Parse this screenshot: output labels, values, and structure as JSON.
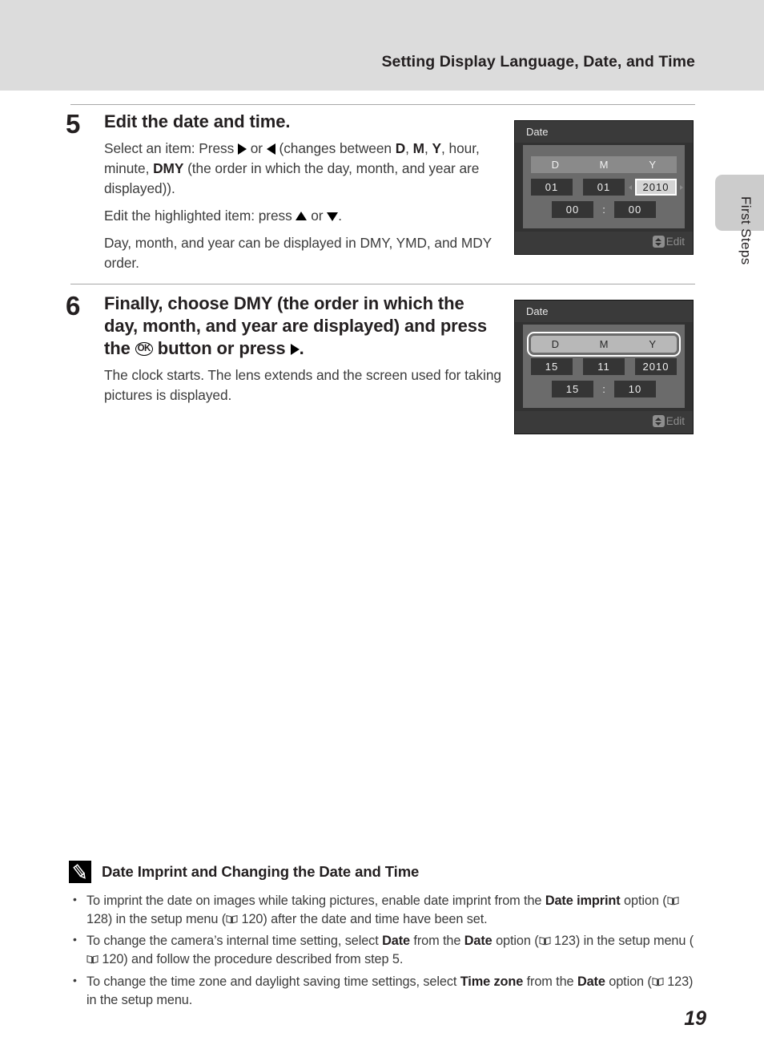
{
  "header": {
    "title": "Setting Display Language, Date, and Time"
  },
  "side_tab": {
    "label": "First Steps"
  },
  "steps": [
    {
      "number": "5",
      "heading": "Edit the date and time.",
      "paragraphs": [
        {
          "segments": [
            {
              "t": "Select an item: Press "
            },
            {
              "icon": "triangle-right-icon"
            },
            {
              "t": " or "
            },
            {
              "icon": "triangle-left-icon"
            },
            {
              "t": " (changes between "
            },
            {
              "t": "D",
              "b": true
            },
            {
              "t": ", "
            },
            {
              "t": "M",
              "b": true
            },
            {
              "t": ", "
            },
            {
              "t": "Y",
              "b": true
            },
            {
              "t": ", hour, minute, "
            },
            {
              "t": "DMY",
              "b": true
            },
            {
              "t": " (the order in which the day, month, and year are displayed))."
            }
          ]
        },
        {
          "segments": [
            {
              "t": "Edit the highlighted item: press "
            },
            {
              "icon": "triangle-up-icon"
            },
            {
              "t": " or "
            },
            {
              "icon": "triangle-down-icon"
            },
            {
              "t": "."
            }
          ]
        },
        {
          "segments": [
            {
              "t": "Day, month, and year can be displayed in DMY, YMD, and MDY order."
            }
          ]
        }
      ]
    },
    {
      "number": "6",
      "heading_segments": [
        {
          "t": "Finally, choose "
        },
        {
          "t": "DMY",
          "b": true
        },
        {
          "t": " (the order in which the day, month, and year are displayed) and press the "
        },
        {
          "icon": "ok-button-icon",
          "label": "OK"
        },
        {
          "t": " button or press "
        },
        {
          "icon": "triangle-right-icon"
        },
        {
          "t": "."
        }
      ],
      "paragraphs": [
        {
          "segments": [
            {
              "t": "The clock starts. The lens extends and the screen used for taking pictures is displayed."
            }
          ]
        }
      ]
    }
  ],
  "camera_screens": [
    {
      "title": "Date",
      "columns": [
        "D",
        "M",
        "Y"
      ],
      "values": [
        "01",
        "01",
        "2010"
      ],
      "selected_field": "year",
      "header_selected": false,
      "hour": "00",
      "minute": "00",
      "separator": ":",
      "footer_label": "Edit",
      "footer_icon": "up-down-arrow-icon"
    },
    {
      "title": "Date",
      "columns": [
        "D",
        "M",
        "Y"
      ],
      "values": [
        "15",
        "11",
        "2010"
      ],
      "selected_field": "order",
      "header_selected": true,
      "hour": "15",
      "minute": "10",
      "separator": ":",
      "footer_label": "Edit",
      "footer_icon": "up-down-arrow-icon"
    }
  ],
  "note": {
    "icon": "pencil-icon",
    "title": "Date Imprint and Changing the Date and Time",
    "bullets": [
      {
        "segments": [
          {
            "t": "To imprint the date on images while taking pictures, enable date imprint from the "
          },
          {
            "t": "Date imprint",
            "b": true
          },
          {
            "t": " option ("
          },
          {
            "icon": "book-icon"
          },
          {
            "t": " 128) in the setup menu ("
          },
          {
            "icon": "book-icon"
          },
          {
            "t": " 120) after the date and time have been set."
          }
        ]
      },
      {
        "segments": [
          {
            "t": "To change the camera’s internal time setting, select "
          },
          {
            "t": "Date",
            "b": true
          },
          {
            "t": " from the "
          },
          {
            "t": "Date",
            "b": true
          },
          {
            "t": " option ("
          },
          {
            "icon": "book-icon"
          },
          {
            "t": " 123) in the setup menu ("
          },
          {
            "icon": "book-icon"
          },
          {
            "t": " 120) and follow the procedure described from step 5."
          }
        ]
      },
      {
        "segments": [
          {
            "t": "To change the time zone and daylight saving time settings, select "
          },
          {
            "t": "Time zone",
            "b": true
          },
          {
            "t": " from the "
          },
          {
            "t": "Date",
            "b": true
          },
          {
            "t": " option ("
          },
          {
            "icon": "book-icon"
          },
          {
            "t": " 123) in the setup menu."
          }
        ]
      }
    ]
  },
  "page_number": "19",
  "colors": {
    "header_band": "#dcdcdc",
    "side_tab": "#cccccc",
    "screen_bg": "#323232",
    "screen_stage": "#6b6b6b",
    "text": "#231f20"
  }
}
